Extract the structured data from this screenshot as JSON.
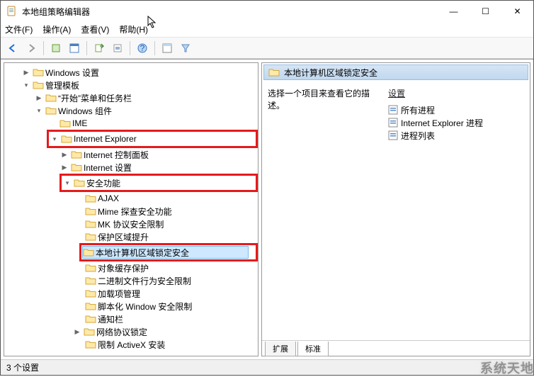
{
  "window": {
    "title": "本地组策略编辑器",
    "controls": {
      "min": "—",
      "max": "☐",
      "close": "✕"
    }
  },
  "menu": {
    "file": "文件(F)",
    "action": "操作(A)",
    "view": "查看(V)",
    "help": "帮助(H)"
  },
  "tree": {
    "n1": "Windows 设置",
    "n2": "管理模板",
    "n3": "“开始”菜单和任务栏",
    "n4": "Windows 组件",
    "n5": "IME",
    "n6": "Internet Explorer",
    "n7": "Internet 控制面板",
    "n8": "Internet 设置",
    "n9": "安全功能",
    "n10": "AJAX",
    "n11": "Mime 探查安全功能",
    "n12": "MK 协议安全限制",
    "n13": "保护区域提升",
    "n14": "本地计算机区域锁定安全",
    "n15": "对象缓存保护",
    "n16": "二进制文件行为安全限制",
    "n17": "加载项管理",
    "n18": "脚本化 Window 安全限制",
    "n19": "通知栏",
    "n20": "网络协议锁定",
    "n21": "限制 ActiveX 安装"
  },
  "right": {
    "header": "本地计算机区域锁定安全",
    "desc": "选择一个项目来查看它的描述。",
    "settings_header": "设置",
    "items": {
      "i1": "所有进程",
      "i2": "Internet Explorer 进程",
      "i3": "进程列表"
    },
    "tabs": {
      "ext": "扩展",
      "std": "标准"
    }
  },
  "statusbar": "3 个设置",
  "watermark": "系统天地"
}
